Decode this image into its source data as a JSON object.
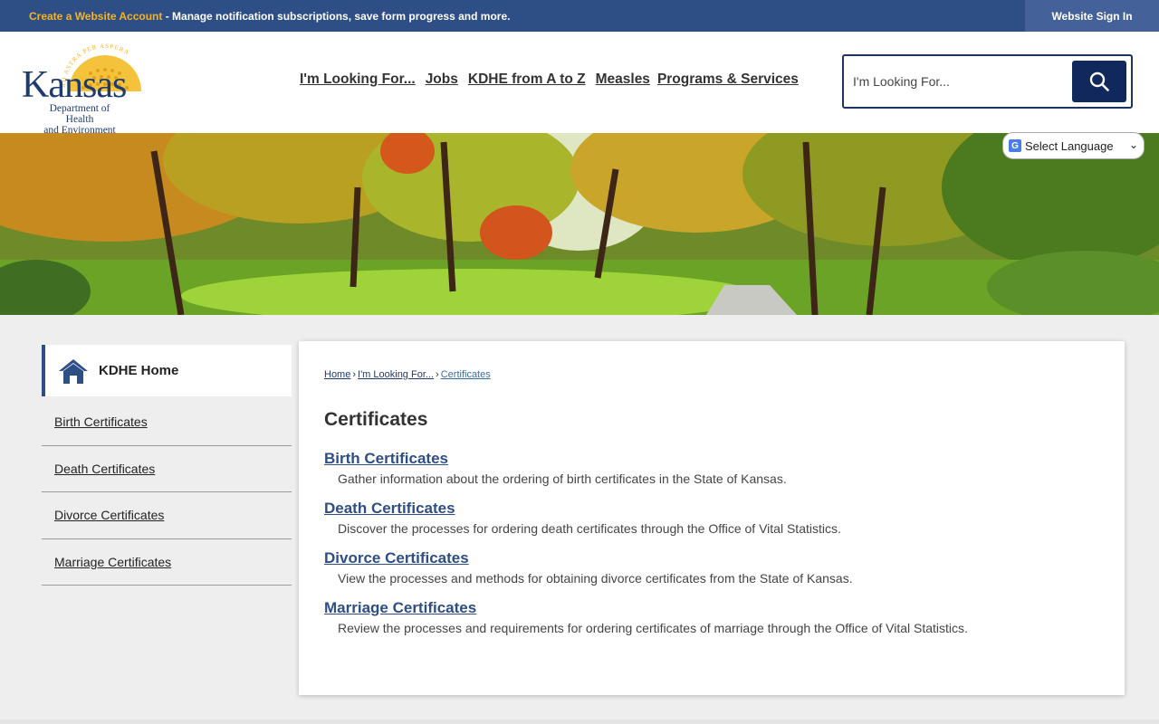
{
  "topbar": {
    "account_link": "Create a Website Account",
    "account_text": " - Manage notification subscriptions, save form progress and more.",
    "signin": "Website Sign In"
  },
  "logo": {
    "motto": "AD ASTRA PER ASPERA",
    "name": "Kansas",
    "sub_line1": "Department of Health",
    "sub_line2": "and Environment"
  },
  "nav": {
    "items": [
      "I'm Looking For...",
      "Jobs",
      "KDHE from A to Z",
      "Measles",
      "Programs & Services"
    ]
  },
  "search": {
    "placeholder": "I'm Looking For..."
  },
  "language": {
    "label": "Select Language"
  },
  "sidebar": {
    "home": "KDHE Home",
    "items": [
      "Birth Certificates",
      "Death Certificates",
      "Divorce Certificates",
      "Marriage Certificates"
    ]
  },
  "breadcrumb": {
    "home": "Home",
    "parent": "I'm Looking For...",
    "current": "Certificates"
  },
  "main": {
    "title": "Certificates",
    "entries": [
      {
        "title": "Birth Certificates",
        "desc": "Gather information about the ordering of birth certificates in the State of Kansas."
      },
      {
        "title": "Death Certificates",
        "desc": "Discover the processes for ordering death certificates through the Office of Vital Statistics."
      },
      {
        "title": "Divorce Certificates",
        "desc": "View the processes and methods for obtaining divorce certificates from the State of Kansas."
      },
      {
        "title": "Marriage Certificates",
        "desc": "Review the processes and requirements for ordering certificates of marriage through the Office of Vital Statistics."
      }
    ]
  },
  "colors": {
    "topbar": "#2e4e86",
    "accent_gold": "#f5b324",
    "search_button": "#11285c",
    "link": "#2e4e86"
  }
}
